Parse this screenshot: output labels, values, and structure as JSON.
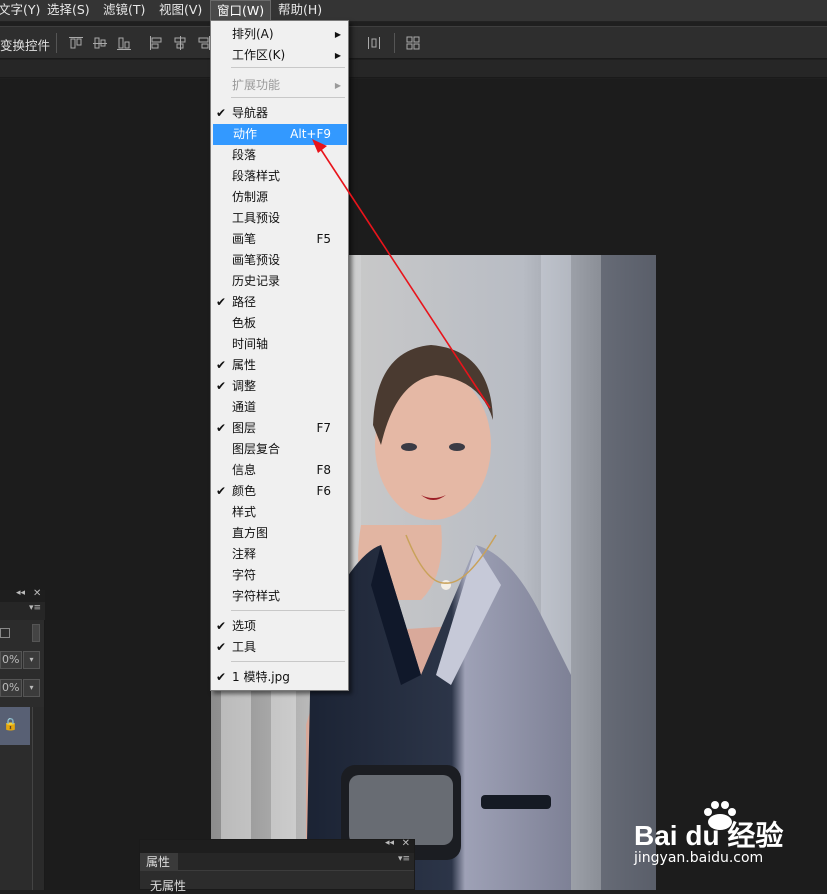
{
  "menubar": {
    "items": [
      "文字(Y)",
      "选择(S)",
      "滤镜(T)",
      "视图(V)",
      "窗口(W)",
      "帮助(H)"
    ],
    "active": "窗口(W)"
  },
  "options_bar": {
    "transform_label": "变换控件"
  },
  "window_menu": {
    "items": [
      {
        "label": "排列(A)",
        "submenu": true
      },
      {
        "label": "工作区(K)",
        "submenu": true
      },
      {
        "label": "扩展功能",
        "submenu": true,
        "disabled": true
      },
      {
        "label": "导航器",
        "checked": true
      },
      {
        "label": "动作",
        "shortcut": "Alt+F9",
        "highlighted": true
      },
      {
        "label": "段落"
      },
      {
        "label": "段落样式"
      },
      {
        "label": "仿制源"
      },
      {
        "label": "工具预设"
      },
      {
        "label": "画笔",
        "shortcut": "F5"
      },
      {
        "label": "画笔预设"
      },
      {
        "label": "历史记录"
      },
      {
        "label": "路径",
        "checked": true
      },
      {
        "label": "色板"
      },
      {
        "label": "时间轴"
      },
      {
        "label": "属性",
        "checked": true
      },
      {
        "label": "调整",
        "checked": true
      },
      {
        "label": "通道"
      },
      {
        "label": "图层",
        "shortcut": "F7",
        "checked": true
      },
      {
        "label": "图层复合"
      },
      {
        "label": "信息",
        "shortcut": "F8"
      },
      {
        "label": "颜色",
        "shortcut": "F6",
        "checked": true
      },
      {
        "label": "样式"
      },
      {
        "label": "直方图"
      },
      {
        "label": "注释"
      },
      {
        "label": "字符"
      },
      {
        "label": "字符样式"
      },
      {
        "label": "选项",
        "checked": true
      },
      {
        "label": "工具",
        "checked": true
      },
      {
        "label": "1 模特.jpg",
        "checked": true
      }
    ]
  },
  "left_panel": {
    "opacity_value": "0%",
    "fill_value": "0%"
  },
  "properties_panel": {
    "tab_label": "属性",
    "body_text": "无属性"
  },
  "watermark": {
    "brand": "Bai du 经验",
    "url": "jingyan.baidu.com"
  },
  "colors": {
    "highlight": "#3399ff",
    "annotation_arrow": "#e8141b"
  }
}
